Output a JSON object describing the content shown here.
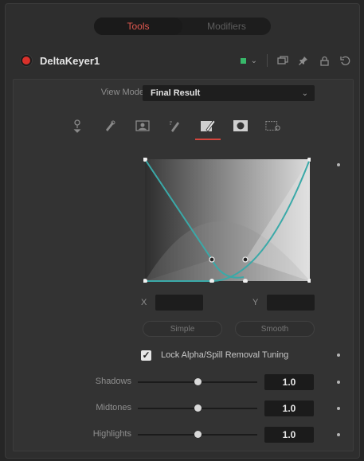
{
  "tabs": [
    {
      "label": "Tools",
      "active": true
    },
    {
      "label": "Modifiers",
      "active": false
    }
  ],
  "header": {
    "tool_name": "DeltaKeyer1",
    "status_color": "#38b96a",
    "icons": [
      "version-icon",
      "pin-icon",
      "lock-icon",
      "reset-icon"
    ]
  },
  "view_mode": {
    "label": "View Mode",
    "value": "Final Result"
  },
  "page_icons": [
    "key-icon",
    "pre-matte-icon",
    "matte-icon",
    "fringe-icon",
    "tuning-icon",
    "mask-icon",
    "settings-icon"
  ],
  "active_page": "tuning-icon",
  "curve": {
    "x_label": "X",
    "y_label": "Y",
    "x_value": "",
    "y_value": "",
    "buttons": [
      "Simple",
      "Smooth"
    ],
    "curve_color": "#3aa9a8"
  },
  "lock_tuning": {
    "label": "Lock Alpha/Spill Removal Tuning",
    "checked": true
  },
  "sliders": [
    {
      "label": "Shadows",
      "value": "1.0",
      "level": 0.5
    },
    {
      "label": "Midtones",
      "value": "1.0",
      "level": 0.5
    },
    {
      "label": "Highlights",
      "value": "1.0",
      "level": 0.5
    }
  ]
}
